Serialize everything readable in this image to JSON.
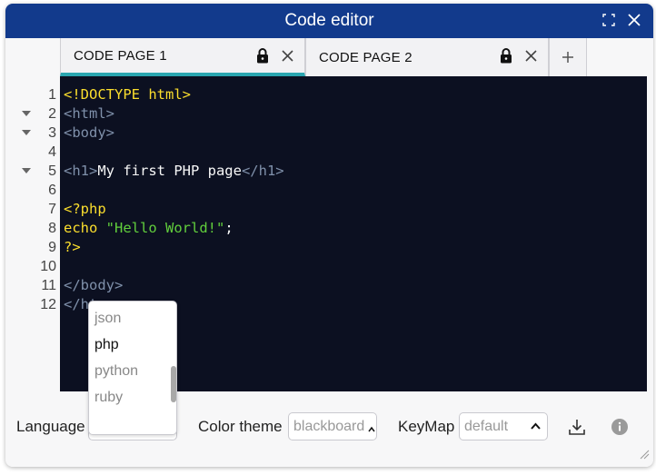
{
  "window": {
    "title": "Code editor"
  },
  "tabs": [
    {
      "label": "CODE PAGE 1",
      "active": true
    },
    {
      "label": "CODE PAGE 2",
      "active": false
    }
  ],
  "add_tab_label": "+",
  "editor": {
    "theme_colors": {
      "background": "#0c1021",
      "tag": "#7f90aa",
      "keyword": "#fbde2d",
      "text": "#f8f8f8",
      "string": "#61ce3c"
    },
    "lines": [
      {
        "n": "1",
        "fold": false,
        "parts": [
          {
            "c": "kw",
            "t": "<!DOCTYPE html>"
          }
        ]
      },
      {
        "n": "2",
        "fold": true,
        "parts": [
          {
            "c": "tag",
            "t": "<html>"
          }
        ]
      },
      {
        "n": "3",
        "fold": true,
        "parts": [
          {
            "c": "tag",
            "t": "<body>"
          }
        ]
      },
      {
        "n": "4",
        "fold": false,
        "parts": []
      },
      {
        "n": "5",
        "fold": true,
        "parts": [
          {
            "c": "tag",
            "t": "<h1>"
          },
          {
            "c": "txt",
            "t": "My first PHP page"
          },
          {
            "c": "tag",
            "t": "</h1>"
          }
        ]
      },
      {
        "n": "6",
        "fold": false,
        "parts": []
      },
      {
        "n": "7",
        "fold": false,
        "parts": [
          {
            "c": "kw",
            "t": "<?php"
          }
        ]
      },
      {
        "n": "8",
        "fold": false,
        "parts": [
          {
            "c": "kw",
            "t": "echo"
          },
          {
            "c": "txt",
            "t": " "
          },
          {
            "c": "str",
            "t": "\"Hello World!\""
          },
          {
            "c": "txt",
            "t": ";"
          }
        ]
      },
      {
        "n": "9",
        "fold": false,
        "parts": [
          {
            "c": "kw",
            "t": "?>"
          }
        ]
      },
      {
        "n": "10",
        "fold": false,
        "parts": []
      },
      {
        "n": "11",
        "fold": false,
        "parts": [
          {
            "c": "tag",
            "t": "</body>"
          }
        ]
      },
      {
        "n": "12",
        "fold": false,
        "parts": [
          {
            "c": "tag",
            "t": "</ht"
          }
        ]
      }
    ]
  },
  "language_dropdown": {
    "options": [
      "json",
      "php",
      "python",
      "ruby"
    ],
    "selected": "php"
  },
  "toolbar": {
    "language_label": "Language",
    "language_value": "php",
    "color_theme_label": "Color theme",
    "color_theme_value": "blackboard",
    "keymap_label": "KeyMap",
    "keymap_value": "default"
  },
  "icons": {
    "fullscreen": "fullscreen-icon",
    "close": "close-icon",
    "lock": "lock-icon",
    "download": "download-icon",
    "info": "info-icon"
  }
}
